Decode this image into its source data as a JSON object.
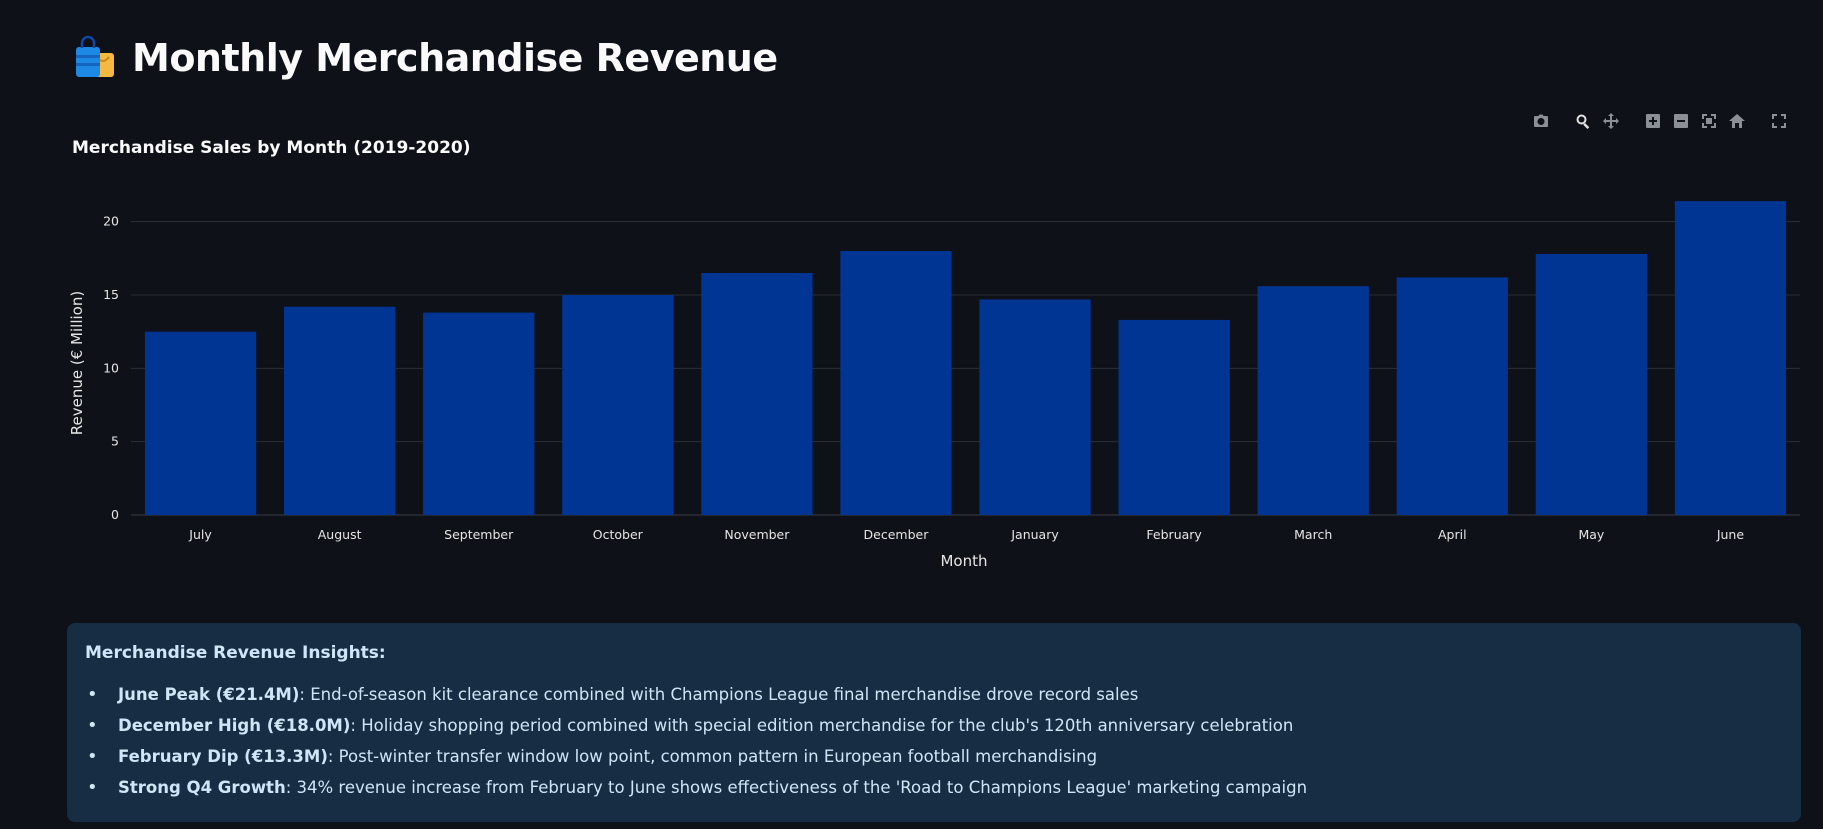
{
  "page": {
    "title": "Monthly Merchandise Revenue",
    "title_icon": "shopping-bags-icon"
  },
  "modebar": [
    "camera-icon",
    "zoom-icon",
    "pan-icon",
    "zoom-in-icon",
    "zoom-out-icon",
    "autoscale-icon",
    "reset-axes-icon",
    "fullscreen-icon"
  ],
  "chart_data": {
    "type": "bar",
    "title": "Merchandise Sales by Month (2019-2020)",
    "xlabel": "Month",
    "ylabel": "Revenue (€ Million)",
    "categories": [
      "July",
      "August",
      "September",
      "October",
      "November",
      "December",
      "January",
      "February",
      "March",
      "April",
      "May",
      "June"
    ],
    "values": [
      12.5,
      14.2,
      13.8,
      15.0,
      16.5,
      18.0,
      14.7,
      13.3,
      15.6,
      16.2,
      17.8,
      21.4
    ],
    "yticks": [
      0,
      5,
      10,
      15,
      20
    ],
    "ylim": [
      0,
      22.5
    ],
    "bar_color": "#003594",
    "grid": true,
    "legend": false
  },
  "insights": {
    "title": "Merchandise Revenue Insights:",
    "items": [
      {
        "bold": "June Peak (€21.4M)",
        "text": ": End-of-season kit clearance combined with Champions League final merchandise drove record sales"
      },
      {
        "bold": "December High (€18.0M)",
        "text": ": Holiday shopping period combined with special edition merchandise for the club's 120th anniversary celebration"
      },
      {
        "bold": "February Dip (€13.3M)",
        "text": ": Post-winter transfer window low point, common pattern in European football merchandising"
      },
      {
        "bold": "Strong Q4 Growth",
        "text": ": 34% revenue increase from February to June shows effectiveness of the 'Road to Champions League' marketing campaign"
      }
    ]
  },
  "colors": {
    "background": "#0e1117",
    "insights_bg": "#172d43",
    "insights_text": "#cfe6f7",
    "gridline": "#2b2f36"
  }
}
